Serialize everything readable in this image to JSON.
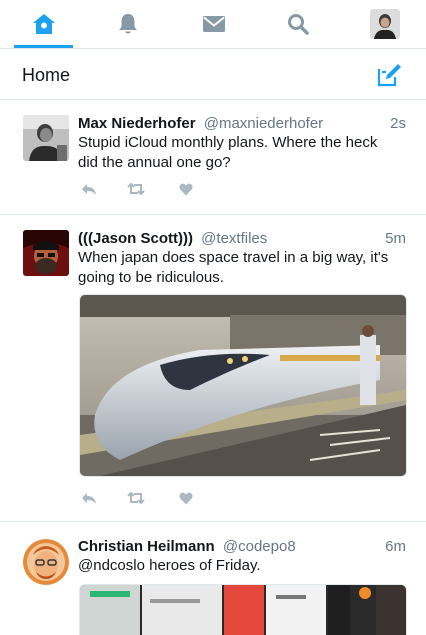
{
  "nav": {
    "items": [
      {
        "name": "home",
        "icon": "home-icon",
        "active": true
      },
      {
        "name": "notifications",
        "icon": "bell-icon",
        "active": false
      },
      {
        "name": "messages",
        "icon": "envelope-icon",
        "active": false
      },
      {
        "name": "search",
        "icon": "search-icon",
        "active": false
      },
      {
        "name": "profile",
        "icon": "avatar",
        "active": false
      }
    ],
    "accent_color": "#1da1f2",
    "inactive_color": "#8899a6"
  },
  "header": {
    "title": "Home",
    "compose_icon": "compose-icon"
  },
  "tweets": [
    {
      "name": "Max Niederhofer",
      "handle": "@maxniederhofer",
      "time": "2s",
      "text": "Stupid iCloud monthly plans. Where the heck did the annual one go?"
    },
    {
      "name": "(((Jason Scott)))",
      "handle": "@textfiles",
      "time": "5m",
      "text": "When japan does space travel in a big way, it's going to be ridiculous."
    },
    {
      "name": "Christian Heilmann",
      "handle": "@codepo8",
      "time": "6m",
      "text": "@ndcoslo heroes of Friday."
    }
  ],
  "actions": {
    "reply_icon": "reply-icon",
    "retweet_icon": "retweet-icon",
    "like_icon": "heart-icon",
    "color": "#aab8c2"
  }
}
